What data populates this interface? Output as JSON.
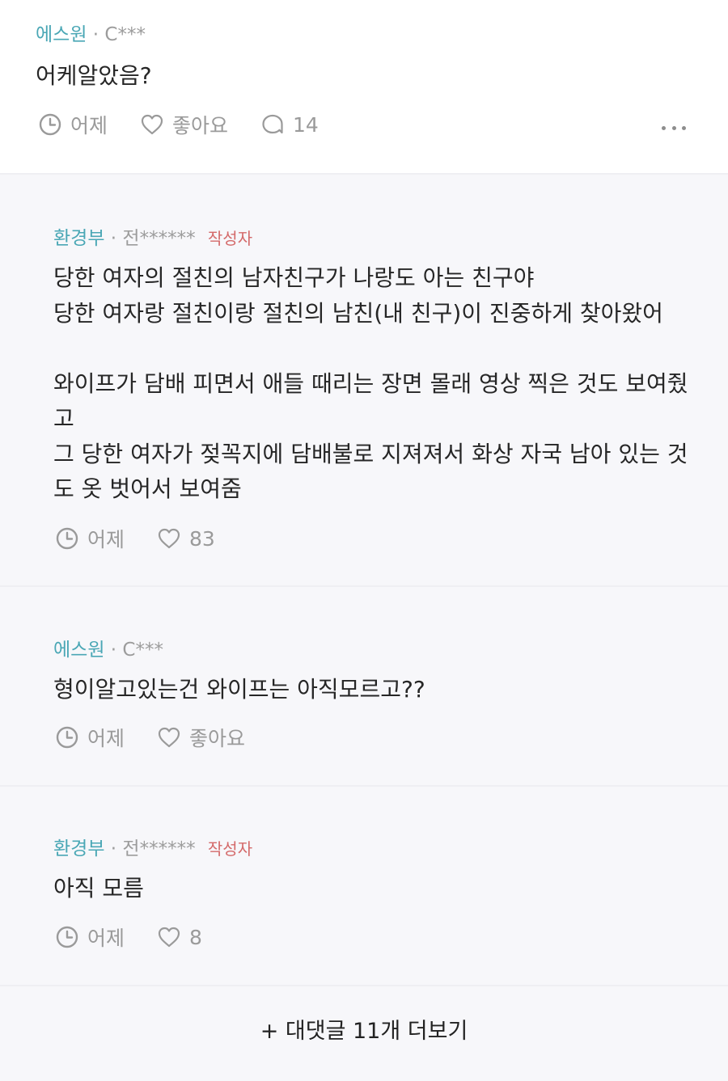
{
  "main_comment": {
    "nickname": "에스원",
    "separator": "·",
    "user_id": "C***",
    "text": "어케알았음?",
    "time": "어제",
    "like_label": "좋아요",
    "reply_count": "14"
  },
  "replies": [
    {
      "nickname": "환경부",
      "separator": "·",
      "user_id": "전******",
      "badge": "작성자",
      "text": "당한 여자의 절친의 남자친구가 나랑도 아는 친구야\n당한 여자랑 절친이랑 절친의 남친(내 친구)이 진중하게 찾아왔어\n\n와이프가 담배 피면서 애들 때리는 장면 몰래 영상 찍은 것도 보여줬고\n그 당한 여자가 젖꼭지에 담배불로 지져져서 화상 자국 남아 있는 것도 옷 벗어서 보여줌",
      "time": "어제",
      "likes": "83"
    },
    {
      "nickname": "에스원",
      "separator": "·",
      "user_id": "C***",
      "text": "형이알고있는건 와이프는 아직모르고??",
      "time": "어제",
      "likes": "좋아요"
    },
    {
      "nickname": "환경부",
      "separator": "·",
      "user_id": "전******",
      "badge": "작성자",
      "text": "아직 모름",
      "time": "어제",
      "likes": "8"
    }
  ],
  "load_more_label": "+ 대댓글 11개 더보기",
  "colors": {
    "nickname": "#4aa7b5",
    "author_badge": "#d46a6a",
    "meta_gray": "#9a9a9a",
    "reply_background": "#f7f7fa"
  },
  "icons": {
    "time": "clock-icon",
    "like": "heart-icon",
    "comment": "speech-bubble-icon",
    "more": "more-dots-icon"
  }
}
